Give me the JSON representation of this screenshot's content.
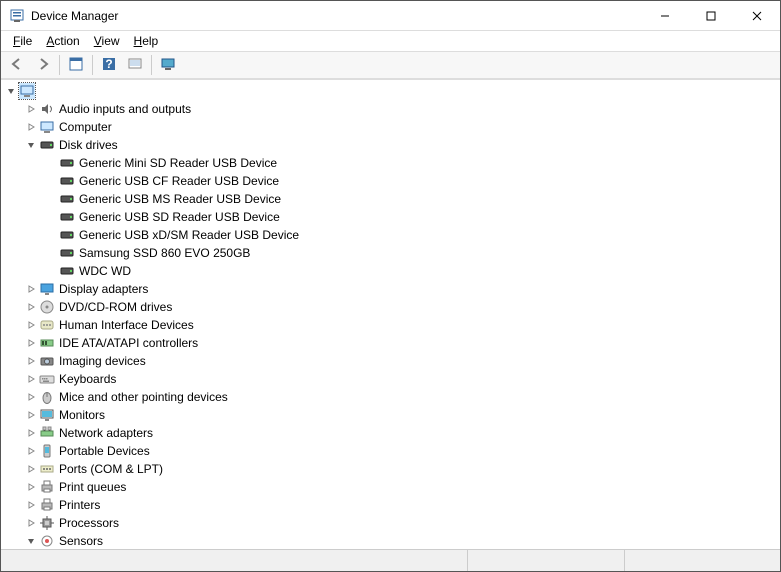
{
  "window": {
    "title": "Device Manager"
  },
  "menu": {
    "file": "File",
    "action": "Action",
    "view": "View",
    "help": "Help"
  },
  "toolbar_icons": {
    "back": "back-arrow-icon",
    "forward": "forward-arrow-icon",
    "properties": "properties-icon",
    "help": "help-icon",
    "scan": "scan-hardware-icon",
    "show_hidden": "show-hidden-icon"
  },
  "tree": {
    "root_icon": "computer-icon",
    "categories": [
      {
        "label": "Audio inputs and outputs",
        "icon": "audio-icon",
        "expanded": false
      },
      {
        "label": "Computer",
        "icon": "computer-icon",
        "expanded": false
      },
      {
        "label": "Disk drives",
        "icon": "disk-icon",
        "expanded": true,
        "children": [
          {
            "label": "Generic Mini SD Reader USB Device",
            "icon": "disk-icon"
          },
          {
            "label": "Generic USB CF Reader USB Device",
            "icon": "disk-icon"
          },
          {
            "label": "Generic USB MS Reader USB Device",
            "icon": "disk-icon"
          },
          {
            "label": "Generic USB SD Reader USB Device",
            "icon": "disk-icon"
          },
          {
            "label": "Generic USB xD/SM Reader USB Device",
            "icon": "disk-icon"
          },
          {
            "label": "Samsung SSD 860 EVO 250GB",
            "icon": "disk-icon"
          },
          {
            "label": "WDC WD",
            "icon": "disk-icon"
          }
        ]
      },
      {
        "label": "Display adapters",
        "icon": "display-icon",
        "expanded": false
      },
      {
        "label": "DVD/CD-ROM drives",
        "icon": "dvd-icon",
        "expanded": false
      },
      {
        "label": "Human Interface Devices",
        "icon": "hid-icon",
        "expanded": false
      },
      {
        "label": "IDE ATA/ATAPI controllers",
        "icon": "ide-icon",
        "expanded": false
      },
      {
        "label": "Imaging devices",
        "icon": "imaging-icon",
        "expanded": false
      },
      {
        "label": "Keyboards",
        "icon": "keyboard-icon",
        "expanded": false
      },
      {
        "label": "Mice and other pointing devices",
        "icon": "mouse-icon",
        "expanded": false
      },
      {
        "label": "Monitors",
        "icon": "monitor-icon",
        "expanded": false
      },
      {
        "label": "Network adapters",
        "icon": "network-icon",
        "expanded": false
      },
      {
        "label": "Portable Devices",
        "icon": "portable-icon",
        "expanded": false
      },
      {
        "label": "Ports (COM & LPT)",
        "icon": "port-icon",
        "expanded": false
      },
      {
        "label": "Print queues",
        "icon": "printqueue-icon",
        "expanded": false
      },
      {
        "label": "Printers",
        "icon": "printer-icon",
        "expanded": false
      },
      {
        "label": "Processors",
        "icon": "cpu-icon",
        "expanded": false
      },
      {
        "label": "Sensors",
        "icon": "sensor-icon",
        "expanded": true
      }
    ]
  }
}
